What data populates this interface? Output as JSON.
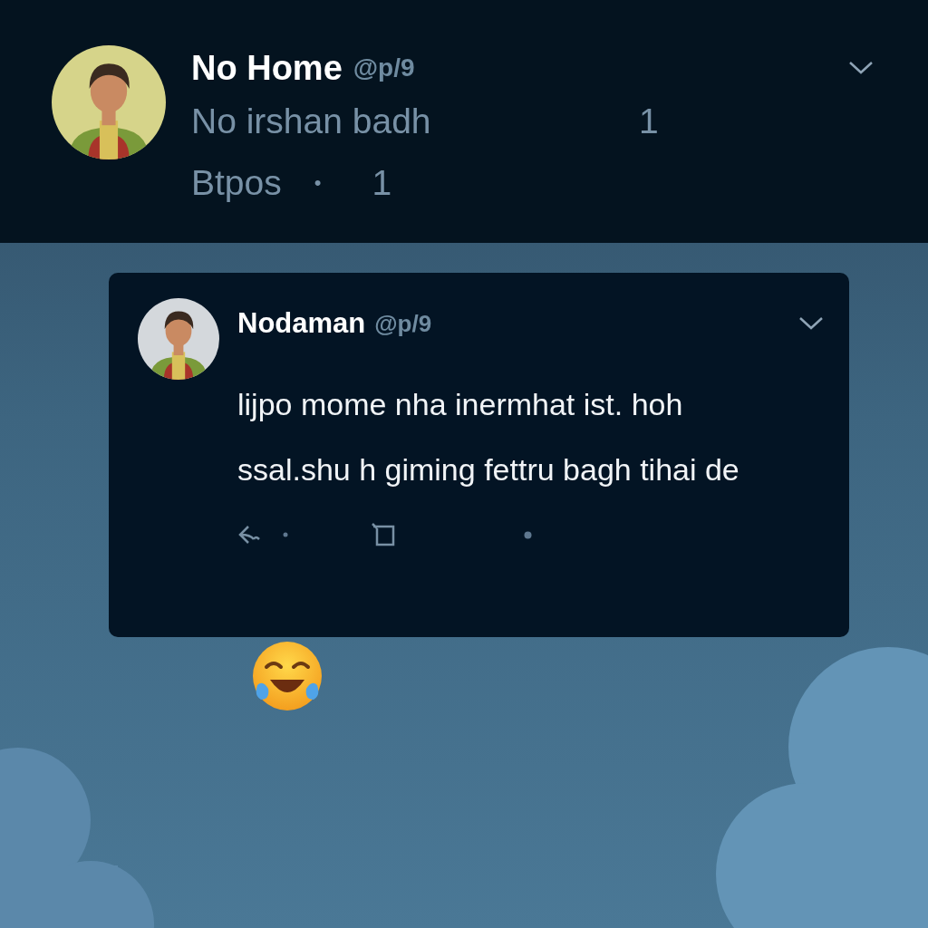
{
  "header": {
    "name": "No Home",
    "handle": "@p/9",
    "subtitle": "No irshan badh",
    "subtitle_count": "1",
    "stat_label": "Btpos",
    "separator": "•",
    "stat_count": "1"
  },
  "reply": {
    "name": "Nodaman",
    "handle": "@p/9",
    "paragraphs": [
      "lijpo mome nha inermhat ist. hoh",
      "ssal.shu h giming fettru bagh tihai de"
    ]
  }
}
